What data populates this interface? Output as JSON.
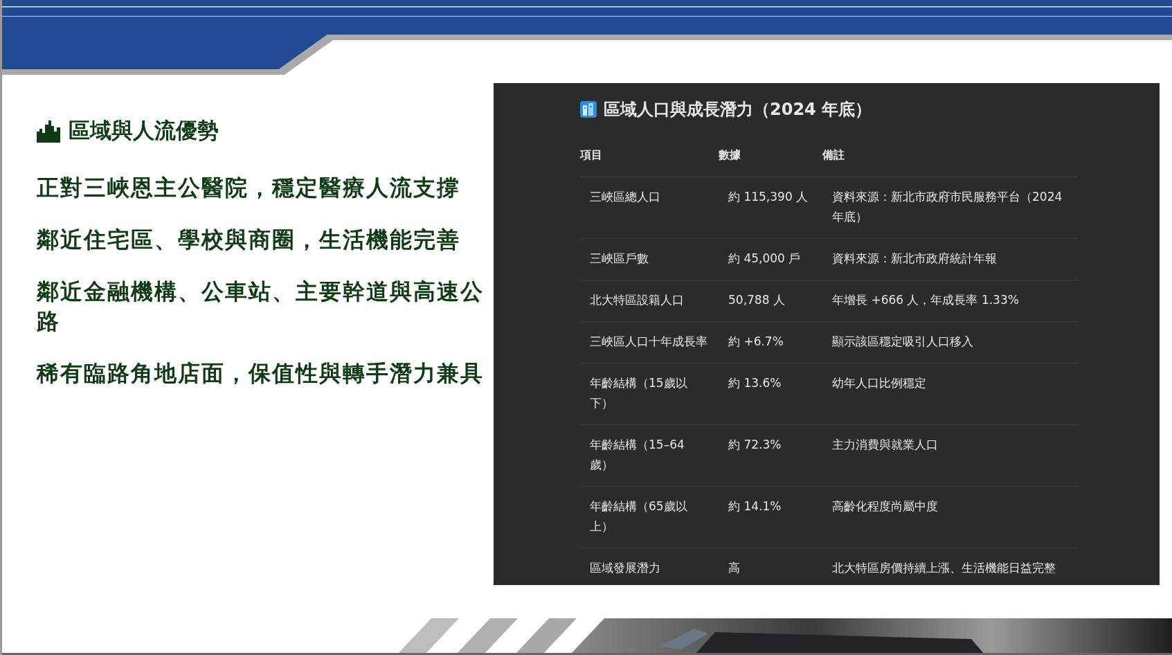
{
  "slide": {
    "heading": "區域與人流優勢",
    "points": [
      "正對三峽恩主公醫院，穩定醫療人流支撐",
      "鄰近住宅區、學校與商圈，生活機能完善",
      "鄰近金融機構、公車站、主要幹道與高速公路",
      "稀有臨路角地店面，保值性與轉手潛力兼具"
    ]
  },
  "panel": {
    "title": "區域人口與成長潛力（2024 年底）",
    "table": {
      "columns": [
        "項目",
        "數據",
        "備註"
      ],
      "rows": [
        [
          "三峽區總人口",
          "約 115,390 人",
          "資料來源：新北市政府市民服務平台（2024 年底）"
        ],
        [
          "三峽區戶數",
          "約 45,000 戶",
          "資料來源：新北市政府統計年報"
        ],
        [
          "北大特區設籍人口",
          "50,788 人",
          "年增長 +666 人，年成長率 1.33%"
        ],
        [
          "三峽區人口十年成長率",
          "約 +6.7%",
          "顯示該區穩定吸引人口移入"
        ],
        [
          "年齡結構（15歲以下）",
          "約 13.6%",
          "幼年人口比例穩定"
        ],
        [
          "年齡結構（15–64 歲）",
          "約 72.3%",
          "主力消費與就業人口"
        ],
        [
          "年齡結構（65歲以上）",
          "約 14.1%",
          "高齡化程度尚屬中度"
        ],
        [
          "區域發展潛力",
          "高",
          "北大特區房價持續上漲、生活機能日益完整"
        ]
      ]
    }
  }
}
